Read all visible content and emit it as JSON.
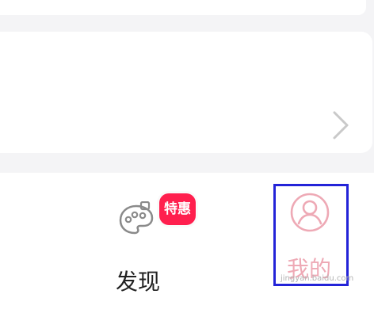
{
  "tabbar": {
    "discover": {
      "label": "发现",
      "badge": "特惠",
      "icon": "palette-icon"
    },
    "me": {
      "label": "我的",
      "icon": "user-circle-icon",
      "highlighted": true
    }
  },
  "content": {
    "chevron_icon": "chevron-right-icon"
  },
  "watermark": "jingyan.baidu.com",
  "colors": {
    "badge": "#ff1f4e",
    "me_active": "#eea9b5",
    "highlight_box": "#2323d8",
    "background": "#f4f4f6"
  }
}
